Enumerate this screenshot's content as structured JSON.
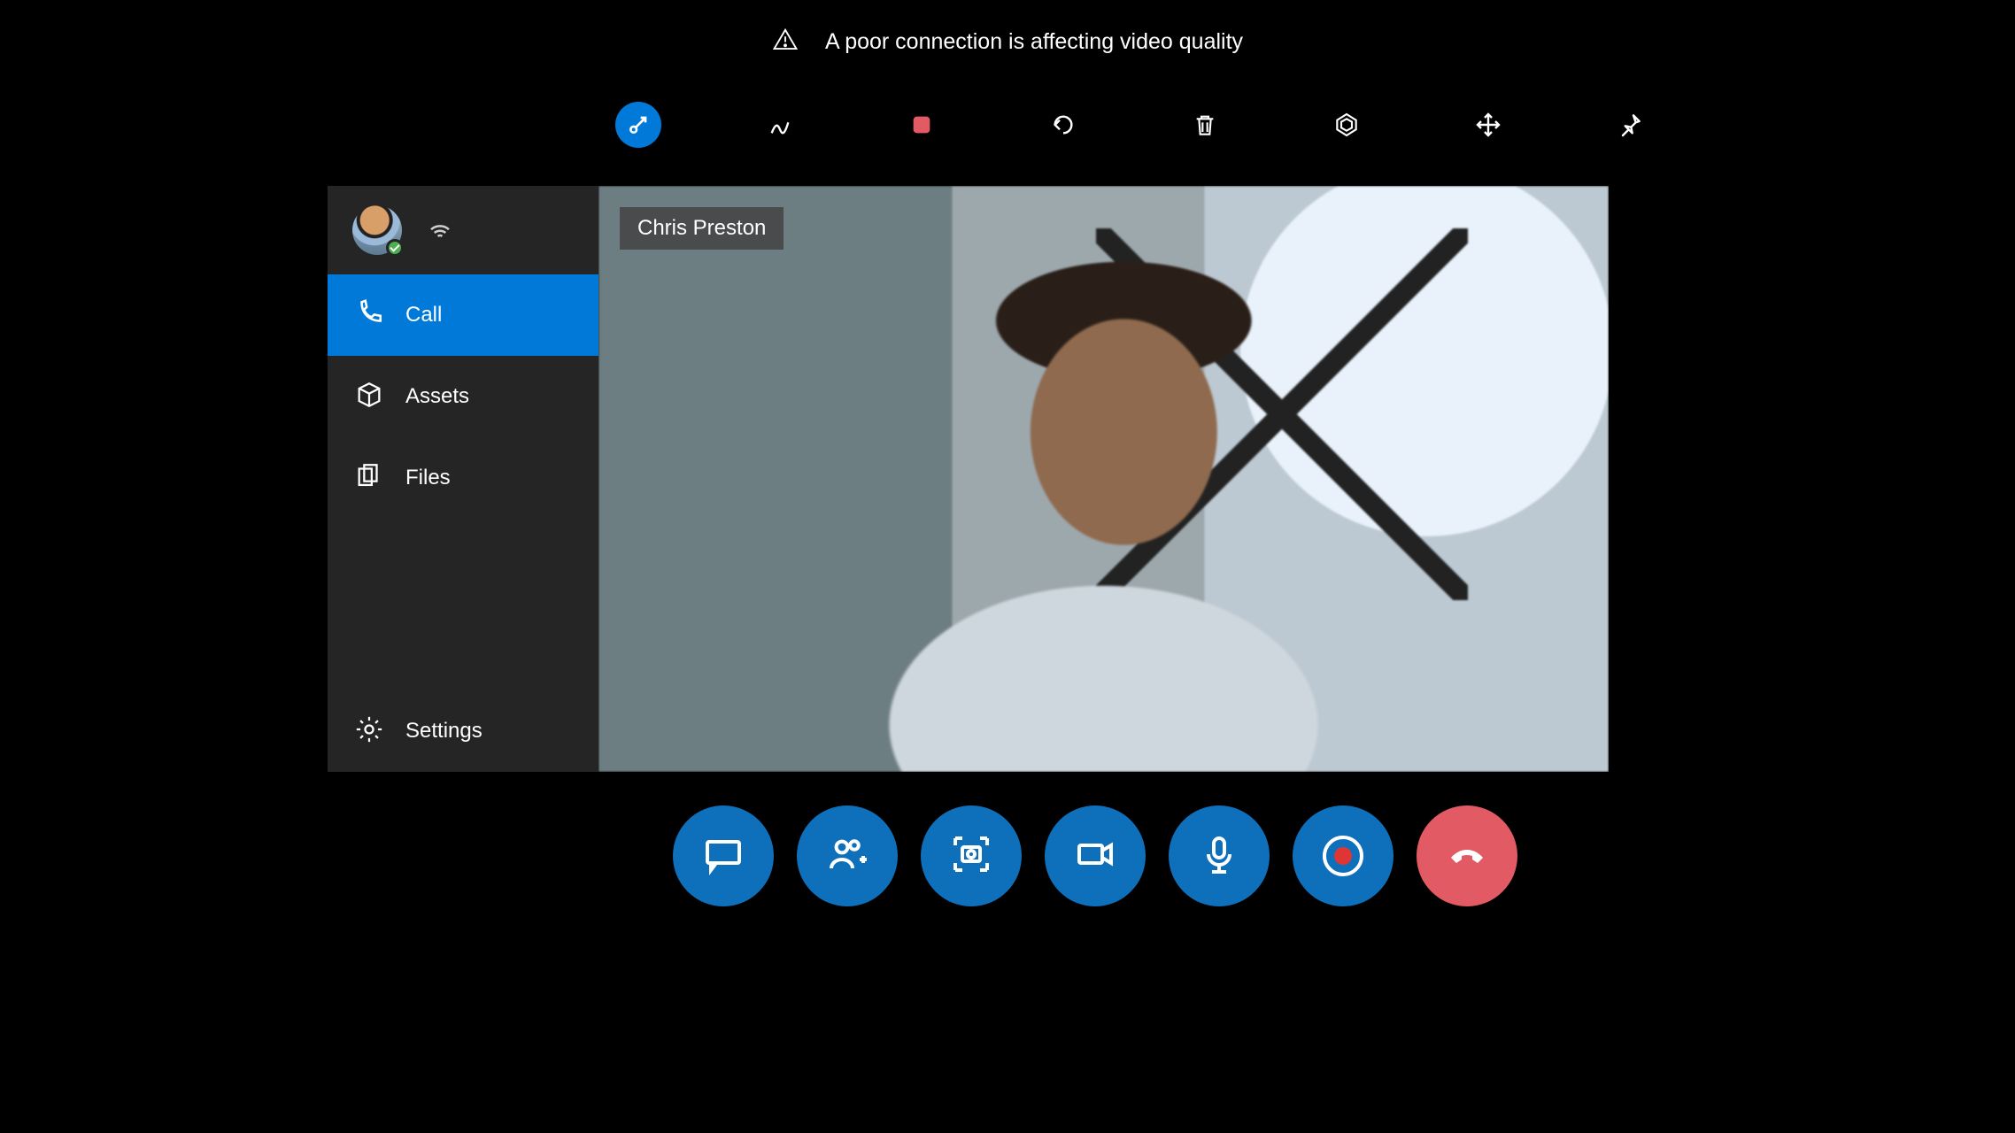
{
  "warning": {
    "text": "A poor connection is affecting video quality"
  },
  "toolbar": {
    "items": [
      {
        "name": "pointer-button",
        "icon": "pointer"
      },
      {
        "name": "ink-button",
        "icon": "ink"
      },
      {
        "name": "stop-button",
        "icon": "stop"
      },
      {
        "name": "undo-button",
        "icon": "undo"
      },
      {
        "name": "delete-button",
        "icon": "trash"
      },
      {
        "name": "3d-view-button",
        "icon": "hex"
      },
      {
        "name": "expand-button",
        "icon": "expand"
      },
      {
        "name": "pin-button",
        "icon": "pin"
      }
    ]
  },
  "sidebar": {
    "items": [
      {
        "name": "sidebar-item-call",
        "label": "Call",
        "icon": "phone",
        "active": true
      },
      {
        "name": "sidebar-item-assets",
        "label": "Assets",
        "icon": "box"
      },
      {
        "name": "sidebar-item-files",
        "label": "Files",
        "icon": "files"
      },
      {
        "name": "sidebar-item-settings",
        "label": "Settings",
        "icon": "gear",
        "pinBottom": true
      }
    ]
  },
  "video": {
    "caller_name": "Chris Preston"
  },
  "callbar": {
    "items": [
      {
        "name": "chat-button",
        "icon": "chat"
      },
      {
        "name": "add-participant-button",
        "icon": "people-add"
      },
      {
        "name": "camera-capture-button",
        "icon": "camera-capture"
      },
      {
        "name": "video-button",
        "icon": "video"
      },
      {
        "name": "mic-button",
        "icon": "mic"
      },
      {
        "name": "record-button",
        "icon": "record"
      },
      {
        "name": "hangup-button",
        "icon": "hangup",
        "color": "red"
      }
    ]
  }
}
